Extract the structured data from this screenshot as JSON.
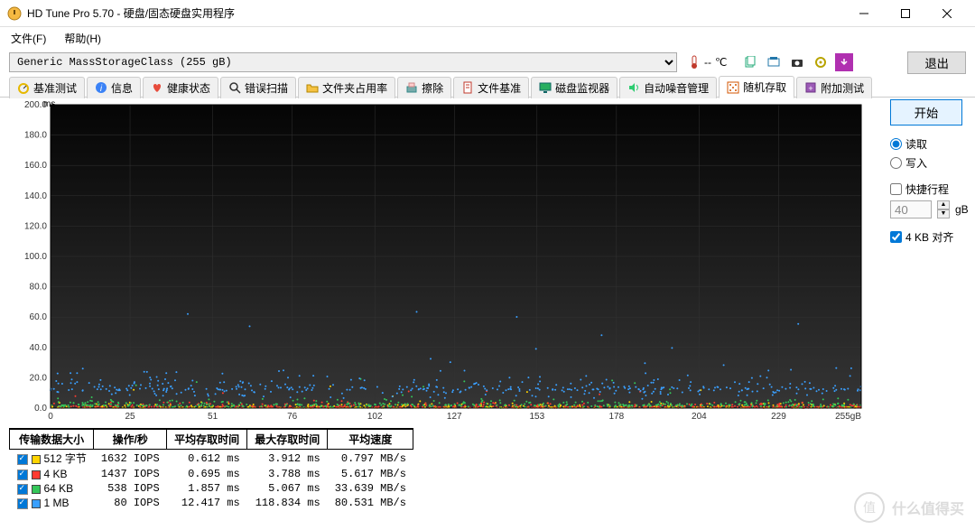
{
  "window": {
    "title": "HD Tune Pro 5.70 - 硬盘/固态硬盘实用程序"
  },
  "menu": {
    "file": "文件(F)",
    "help": "帮助(H)"
  },
  "toolbar": {
    "drive": "Generic MassStorageClass (255 gB)",
    "temp_value": "--",
    "temp_unit": "℃",
    "exit": "退出"
  },
  "tabs": [
    {
      "label": "基准测试",
      "icon": "gauge-icon",
      "active": false
    },
    {
      "label": "信息",
      "icon": "info-icon",
      "active": false
    },
    {
      "label": "健康状态",
      "icon": "heart-icon",
      "active": false
    },
    {
      "label": "错误扫描",
      "icon": "search-icon",
      "active": false
    },
    {
      "label": "文件夹占用率",
      "icon": "folder-icon",
      "active": false
    },
    {
      "label": "擦除",
      "icon": "erase-icon",
      "active": false
    },
    {
      "label": "文件基准",
      "icon": "file-bench-icon",
      "active": false
    },
    {
      "label": "磁盘监视器",
      "icon": "monitor-icon",
      "active": false
    },
    {
      "label": "自动噪音管理",
      "icon": "noise-icon",
      "active": false
    },
    {
      "label": "随机存取",
      "icon": "random-icon",
      "active": true
    },
    {
      "label": "附加测试",
      "icon": "extra-icon",
      "active": false
    }
  ],
  "side": {
    "start": "开始",
    "read": "读取",
    "write": "写入",
    "quick": "快捷行程",
    "spin_value": "40",
    "spin_unit": "gB",
    "align": "4 KB 对齐"
  },
  "chart_data": {
    "type": "scatter",
    "title": "",
    "xlabel": "gB",
    "ylabel": "ms",
    "xlim": [
      0,
      255
    ],
    "ylim": [
      0,
      200
    ],
    "xticks": [
      0,
      25,
      51,
      76,
      102,
      127,
      153,
      178,
      204,
      229
    ],
    "yticks": [
      0,
      20,
      40,
      60,
      80,
      100,
      120,
      140,
      160,
      180,
      200
    ],
    "x_unit_label": "255gB",
    "series": [
      {
        "name": "512 字节",
        "color": "#ffd400",
        "y_mean": 0.6,
        "y_spread": 2,
        "n": 420
      },
      {
        "name": "4 KB",
        "color": "#ff3b30",
        "y_mean": 0.7,
        "y_spread": 2,
        "n": 420
      },
      {
        "name": "64 KB",
        "color": "#34c759",
        "y_mean": 1.9,
        "y_spread": 3,
        "n": 420
      },
      {
        "name": "1 MB",
        "color": "#3aa0ff",
        "y_mean": 12.4,
        "y_spread": 8,
        "n": 420
      }
    ]
  },
  "results": {
    "headers": [
      "传输数据大小",
      "操作/秒",
      "平均存取时间",
      "最大存取时间",
      "平均速度"
    ],
    "rows": [
      {
        "color": "#ffd400",
        "label": "512 字节",
        "iops": "1632 IOPS",
        "avg": "0.612 ms",
        "max": "3.912 ms",
        "speed": "0.797 MB/s"
      },
      {
        "color": "#ff3b30",
        "label": "4 KB",
        "iops": "1437 IOPS",
        "avg": "0.695 ms",
        "max": "3.788 ms",
        "speed": "5.617 MB/s"
      },
      {
        "color": "#34c759",
        "label": "64 KB",
        "iops": "538 IOPS",
        "avg": "1.857 ms",
        "max": "5.067 ms",
        "speed": "33.639 MB/s"
      },
      {
        "color": "#3aa0ff",
        "label": "1 MB",
        "iops": "80 IOPS",
        "avg": "12.417 ms",
        "max": "118.834 ms",
        "speed": "80.531 MB/s"
      }
    ]
  },
  "watermark": {
    "badge": "值",
    "text": "什么值得买"
  }
}
